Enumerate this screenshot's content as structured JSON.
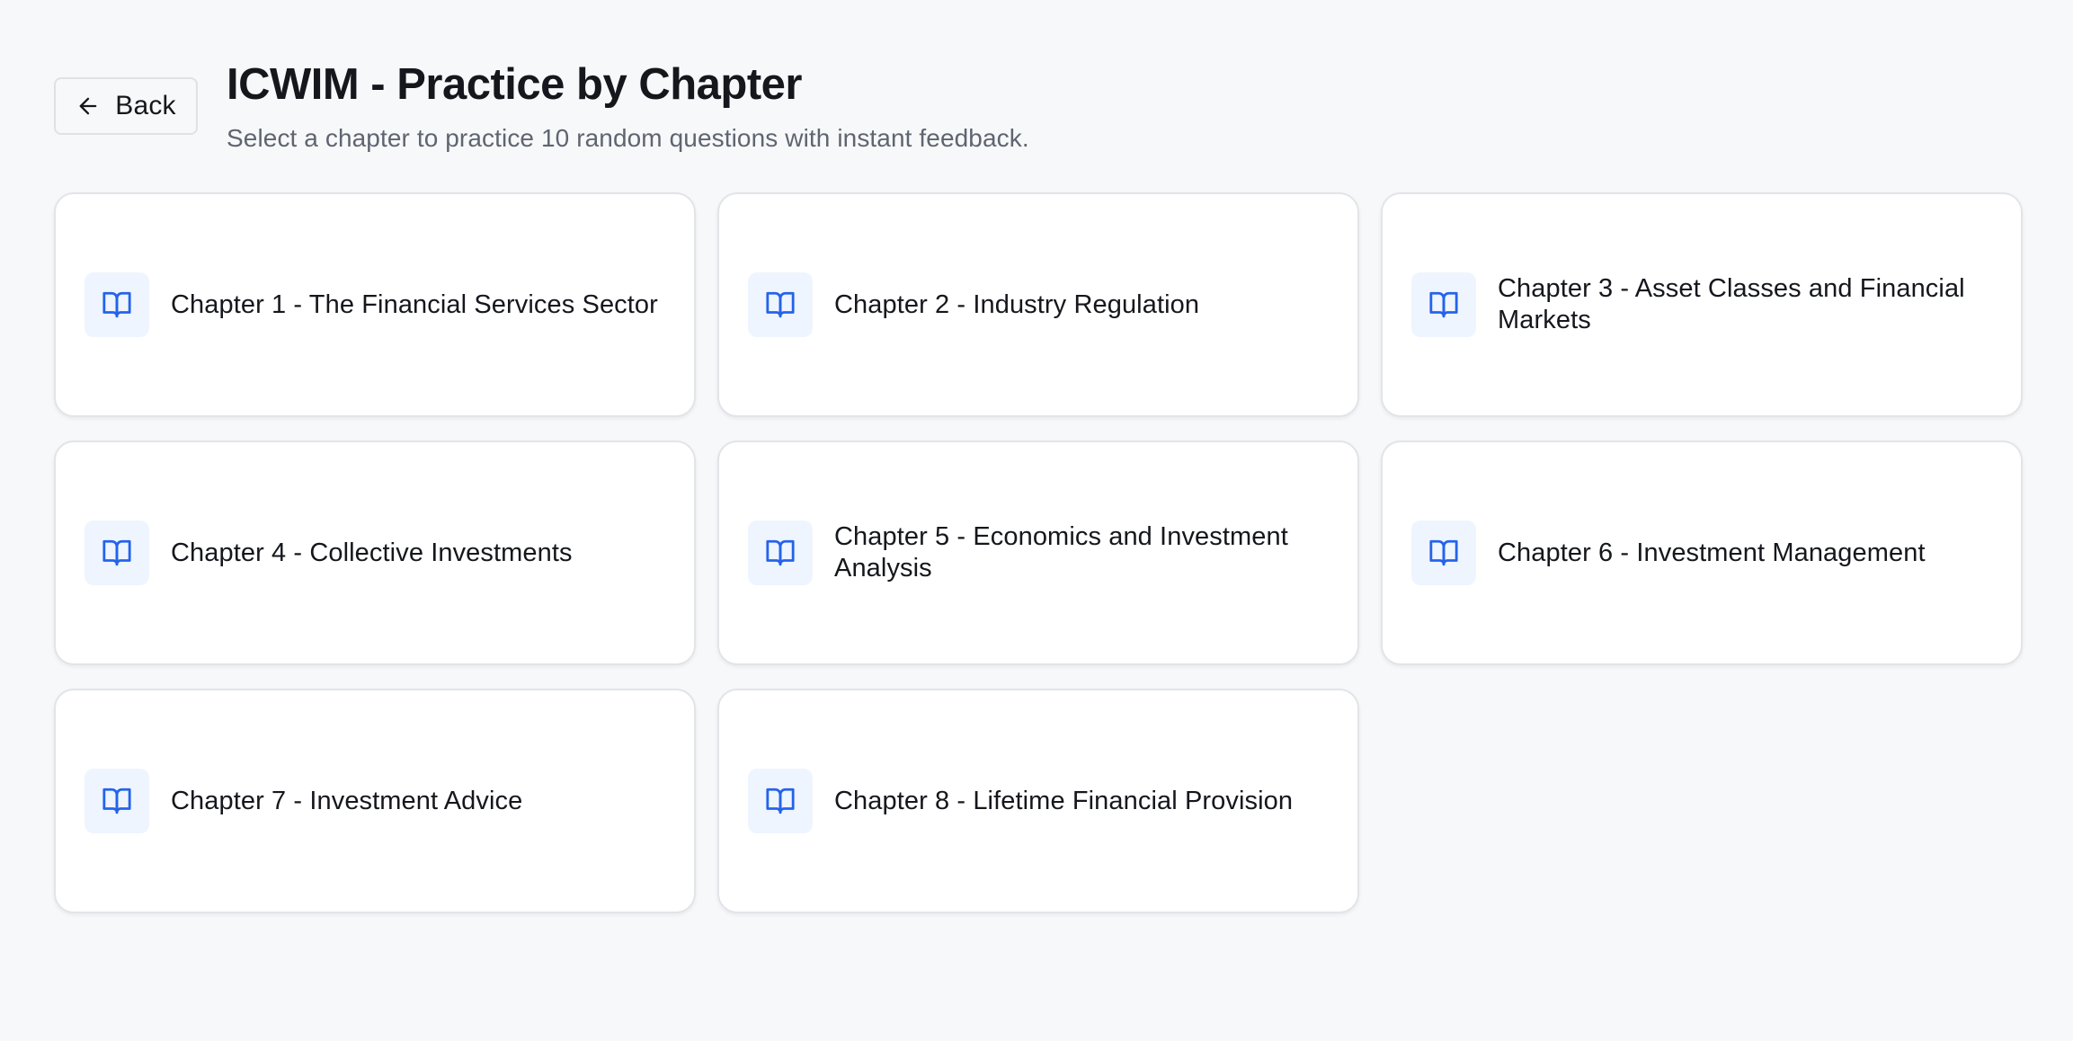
{
  "header": {
    "back_label": "Back",
    "title": "ICWIM - Practice by Chapter",
    "subtitle": "Select a chapter to practice 10 random questions with instant feedback."
  },
  "chapters": [
    {
      "label": "Chapter 1 - The Financial Services Sector",
      "icon": "book-open-icon"
    },
    {
      "label": "Chapter 2 - Industry Regulation",
      "icon": "book-open-icon"
    },
    {
      "label": "Chapter 3 - Asset Classes and Financial Markets",
      "icon": "book-open-icon"
    },
    {
      "label": "Chapter 4 - Collective Investments",
      "icon": "book-open-icon"
    },
    {
      "label": "Chapter 5 - Economics and Investment Analysis",
      "icon": "book-open-icon"
    },
    {
      "label": "Chapter 6 - Investment Management",
      "icon": "book-open-icon"
    },
    {
      "label": "Chapter 7 - Investment Advice",
      "icon": "book-open-icon"
    },
    {
      "label": "Chapter 8 - Lifetime Financial Provision",
      "icon": "book-open-icon"
    }
  ],
  "colors": {
    "background": "#f7f8fa",
    "card": "#ffffff",
    "accent": "#2563eb",
    "icon_bg": "#eff5fe",
    "text_primary": "#15171c",
    "text_secondary": "#5f6570"
  }
}
